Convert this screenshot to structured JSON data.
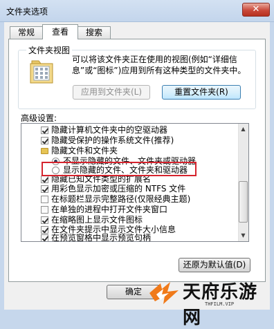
{
  "window": {
    "title": "文件夹选项",
    "close_glyph": "✕"
  },
  "tabs": [
    {
      "label": "常规",
      "active": false
    },
    {
      "label": "查看",
      "active": true
    },
    {
      "label": "搜索",
      "active": false
    }
  ],
  "folder_views": {
    "label": "文件夹视图",
    "description": "可以将该文件夹正在使用的视图(例如“详细信息”或“图标”)应用到所有这种类型的文件夹中。",
    "apply_button": "应用到文件夹(L)",
    "reset_button": "重置文件夹(R)"
  },
  "advanced": {
    "label": "高级设置:",
    "items": [
      {
        "kind": "checkbox",
        "checked": true,
        "label": "隐藏计算机文件夹中的空驱动器"
      },
      {
        "kind": "checkbox",
        "checked": true,
        "label": "隐藏受保护的操作系统文件(推荐)"
      },
      {
        "kind": "folder",
        "label": "隐藏文件和文件夹"
      },
      {
        "kind": "radio",
        "checked": true,
        "label": "不显示隐藏的文件、文件夹或驱动器"
      },
      {
        "kind": "radio",
        "checked": false,
        "label": "显示隐藏的文件、文件夹和驱动器"
      },
      {
        "kind": "checkbox",
        "checked": true,
        "label": "隐藏已知文件类型的扩展名"
      },
      {
        "kind": "checkbox",
        "checked": true,
        "label": "用彩色显示加密或压缩的 NTFS 文件"
      },
      {
        "kind": "checkbox",
        "checked": false,
        "label": "在标题栏显示完整路径(仅限经典主题)"
      },
      {
        "kind": "checkbox",
        "checked": false,
        "label": "在单独的进程中打开文件夹窗口"
      },
      {
        "kind": "checkbox",
        "checked": true,
        "label": "在缩略图上显示文件图标"
      },
      {
        "kind": "checkbox",
        "checked": true,
        "label": "在文件夹提示中显示文件大小信息"
      },
      {
        "kind": "checkbox",
        "checked": true,
        "label": "在预览窗格中显示预览句柄"
      }
    ]
  },
  "restore_button": "还原为默认值(D)",
  "ok_button": "确定",
  "scrollbar": {
    "up_glyph": "▲",
    "down_glyph": "▼"
  },
  "watermark": {
    "name": "天府乐游网",
    "sub": "THFILM.VIP"
  },
  "colors": {
    "highlight": "#d5232d",
    "title_bg": "#c3d5ec",
    "close": "#c9493a"
  }
}
